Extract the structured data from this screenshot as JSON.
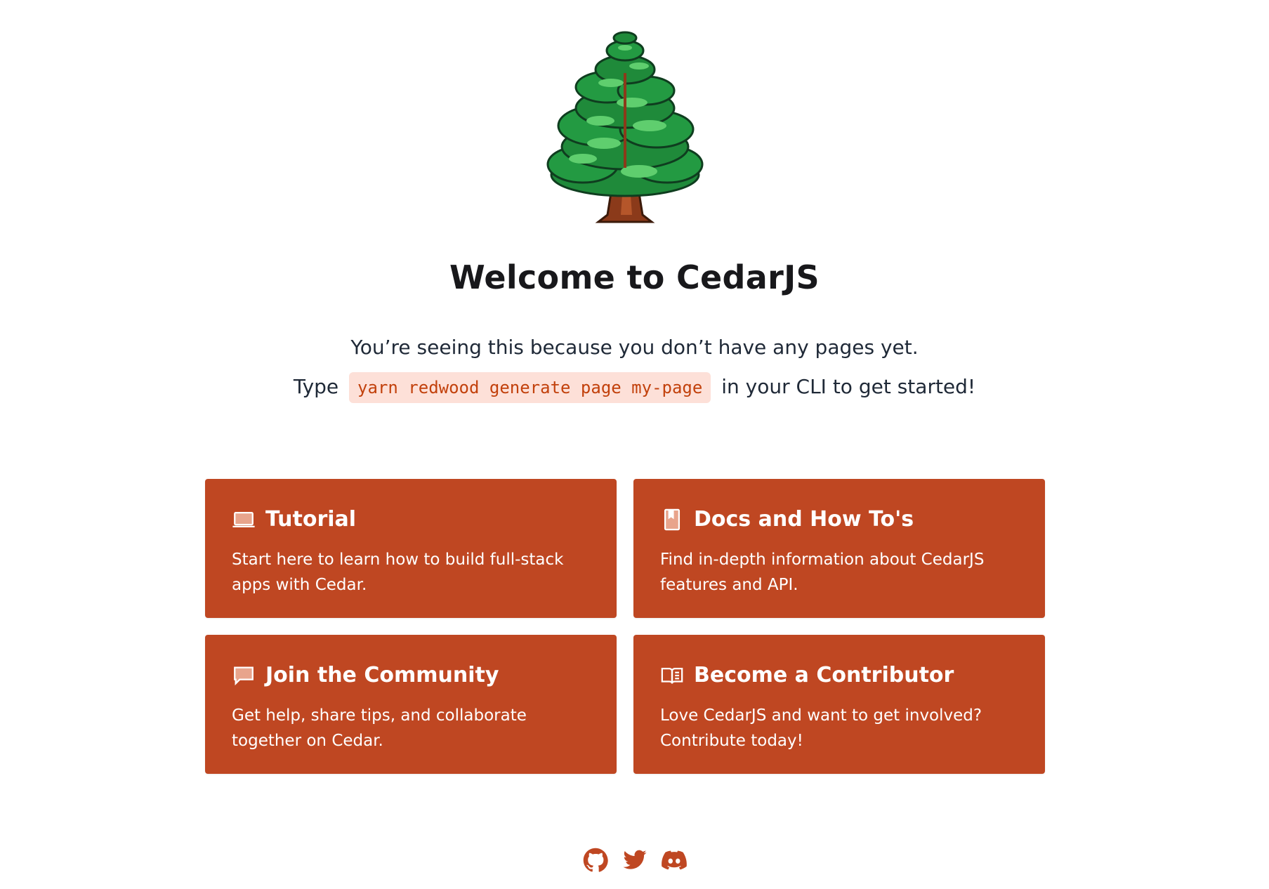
{
  "hero": {
    "logo_icon": "cedar-tree-icon",
    "title": "Welcome to CedarJS",
    "line1": "You’re seeing this because you don’t have any pages yet.",
    "line2_prefix": "Type",
    "command": "yarn redwood generate page my-page",
    "line2_suffix": "in your CLI to get started!"
  },
  "cards": [
    {
      "icon": "laptop-icon",
      "title": "Tutorial",
      "description": "Start here to learn how to build full-stack apps with Cedar."
    },
    {
      "icon": "bookmark-book-icon",
      "title": "Docs and How To's",
      "description": "Find in-depth information about CedarJS features and API."
    },
    {
      "icon": "chat-bubble-icon",
      "title": "Join the Community",
      "description": "Get help, share tips, and collaborate together on Cedar."
    },
    {
      "icon": "open-book-icon",
      "title": "Become a Contributor",
      "description": "Love CedarJS and want to get involved? Contribute today!"
    }
  ],
  "social": [
    "github-icon",
    "twitter-icon",
    "discord-icon"
  ],
  "colors": {
    "accent": "#bf4722",
    "code_text": "#c2410c",
    "code_bg": "#fde0d8"
  }
}
